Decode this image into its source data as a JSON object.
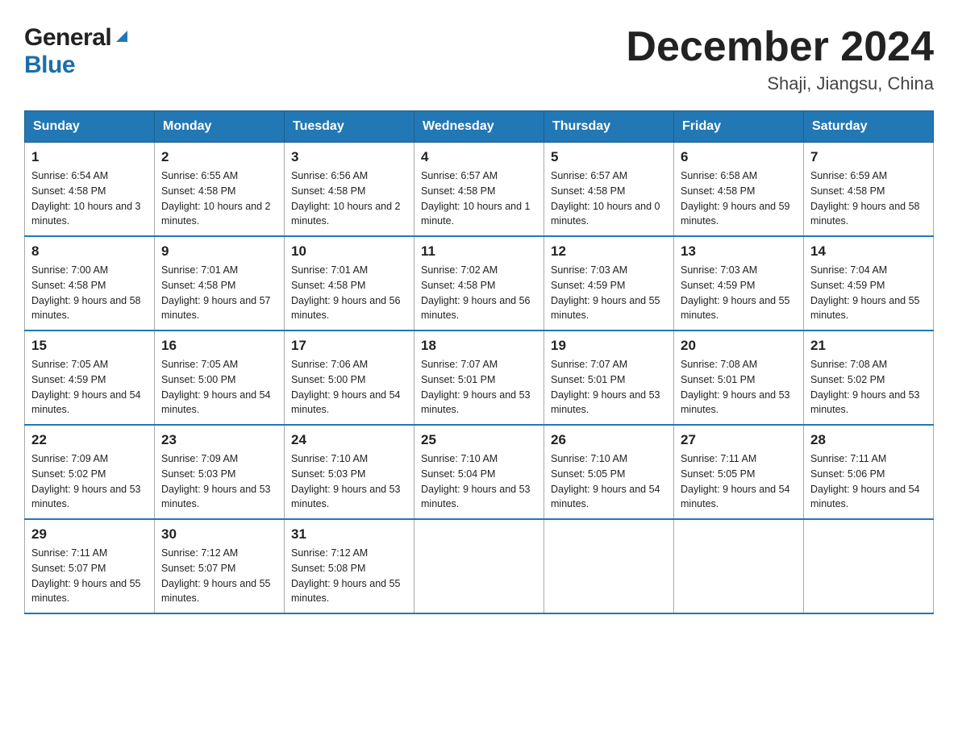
{
  "header": {
    "month": "December 2024",
    "location": "Shaji, Jiangsu, China",
    "logo_general": "General",
    "logo_blue": "Blue"
  },
  "days_of_week": [
    "Sunday",
    "Monday",
    "Tuesday",
    "Wednesday",
    "Thursday",
    "Friday",
    "Saturday"
  ],
  "weeks": [
    [
      {
        "day": "1",
        "sunrise": "6:54 AM",
        "sunset": "4:58 PM",
        "daylight": "10 hours and 3 minutes."
      },
      {
        "day": "2",
        "sunrise": "6:55 AM",
        "sunset": "4:58 PM",
        "daylight": "10 hours and 2 minutes."
      },
      {
        "day": "3",
        "sunrise": "6:56 AM",
        "sunset": "4:58 PM",
        "daylight": "10 hours and 2 minutes."
      },
      {
        "day": "4",
        "sunrise": "6:57 AM",
        "sunset": "4:58 PM",
        "daylight": "10 hours and 1 minute."
      },
      {
        "day": "5",
        "sunrise": "6:57 AM",
        "sunset": "4:58 PM",
        "daylight": "10 hours and 0 minutes."
      },
      {
        "day": "6",
        "sunrise": "6:58 AM",
        "sunset": "4:58 PM",
        "daylight": "9 hours and 59 minutes."
      },
      {
        "day": "7",
        "sunrise": "6:59 AM",
        "sunset": "4:58 PM",
        "daylight": "9 hours and 58 minutes."
      }
    ],
    [
      {
        "day": "8",
        "sunrise": "7:00 AM",
        "sunset": "4:58 PM",
        "daylight": "9 hours and 58 minutes."
      },
      {
        "day": "9",
        "sunrise": "7:01 AM",
        "sunset": "4:58 PM",
        "daylight": "9 hours and 57 minutes."
      },
      {
        "day": "10",
        "sunrise": "7:01 AM",
        "sunset": "4:58 PM",
        "daylight": "9 hours and 56 minutes."
      },
      {
        "day": "11",
        "sunrise": "7:02 AM",
        "sunset": "4:58 PM",
        "daylight": "9 hours and 56 minutes."
      },
      {
        "day": "12",
        "sunrise": "7:03 AM",
        "sunset": "4:59 PM",
        "daylight": "9 hours and 55 minutes."
      },
      {
        "day": "13",
        "sunrise": "7:03 AM",
        "sunset": "4:59 PM",
        "daylight": "9 hours and 55 minutes."
      },
      {
        "day": "14",
        "sunrise": "7:04 AM",
        "sunset": "4:59 PM",
        "daylight": "9 hours and 55 minutes."
      }
    ],
    [
      {
        "day": "15",
        "sunrise": "7:05 AM",
        "sunset": "4:59 PM",
        "daylight": "9 hours and 54 minutes."
      },
      {
        "day": "16",
        "sunrise": "7:05 AM",
        "sunset": "5:00 PM",
        "daylight": "9 hours and 54 minutes."
      },
      {
        "day": "17",
        "sunrise": "7:06 AM",
        "sunset": "5:00 PM",
        "daylight": "9 hours and 54 minutes."
      },
      {
        "day": "18",
        "sunrise": "7:07 AM",
        "sunset": "5:01 PM",
        "daylight": "9 hours and 53 minutes."
      },
      {
        "day": "19",
        "sunrise": "7:07 AM",
        "sunset": "5:01 PM",
        "daylight": "9 hours and 53 minutes."
      },
      {
        "day": "20",
        "sunrise": "7:08 AM",
        "sunset": "5:01 PM",
        "daylight": "9 hours and 53 minutes."
      },
      {
        "day": "21",
        "sunrise": "7:08 AM",
        "sunset": "5:02 PM",
        "daylight": "9 hours and 53 minutes."
      }
    ],
    [
      {
        "day": "22",
        "sunrise": "7:09 AM",
        "sunset": "5:02 PM",
        "daylight": "9 hours and 53 minutes."
      },
      {
        "day": "23",
        "sunrise": "7:09 AM",
        "sunset": "5:03 PM",
        "daylight": "9 hours and 53 minutes."
      },
      {
        "day": "24",
        "sunrise": "7:10 AM",
        "sunset": "5:03 PM",
        "daylight": "9 hours and 53 minutes."
      },
      {
        "day": "25",
        "sunrise": "7:10 AM",
        "sunset": "5:04 PM",
        "daylight": "9 hours and 53 minutes."
      },
      {
        "day": "26",
        "sunrise": "7:10 AM",
        "sunset": "5:05 PM",
        "daylight": "9 hours and 54 minutes."
      },
      {
        "day": "27",
        "sunrise": "7:11 AM",
        "sunset": "5:05 PM",
        "daylight": "9 hours and 54 minutes."
      },
      {
        "day": "28",
        "sunrise": "7:11 AM",
        "sunset": "5:06 PM",
        "daylight": "9 hours and 54 minutes."
      }
    ],
    [
      {
        "day": "29",
        "sunrise": "7:11 AM",
        "sunset": "5:07 PM",
        "daylight": "9 hours and 55 minutes."
      },
      {
        "day": "30",
        "sunrise": "7:12 AM",
        "sunset": "5:07 PM",
        "daylight": "9 hours and 55 minutes."
      },
      {
        "day": "31",
        "sunrise": "7:12 AM",
        "sunset": "5:08 PM",
        "daylight": "9 hours and 55 minutes."
      },
      null,
      null,
      null,
      null
    ]
  ]
}
